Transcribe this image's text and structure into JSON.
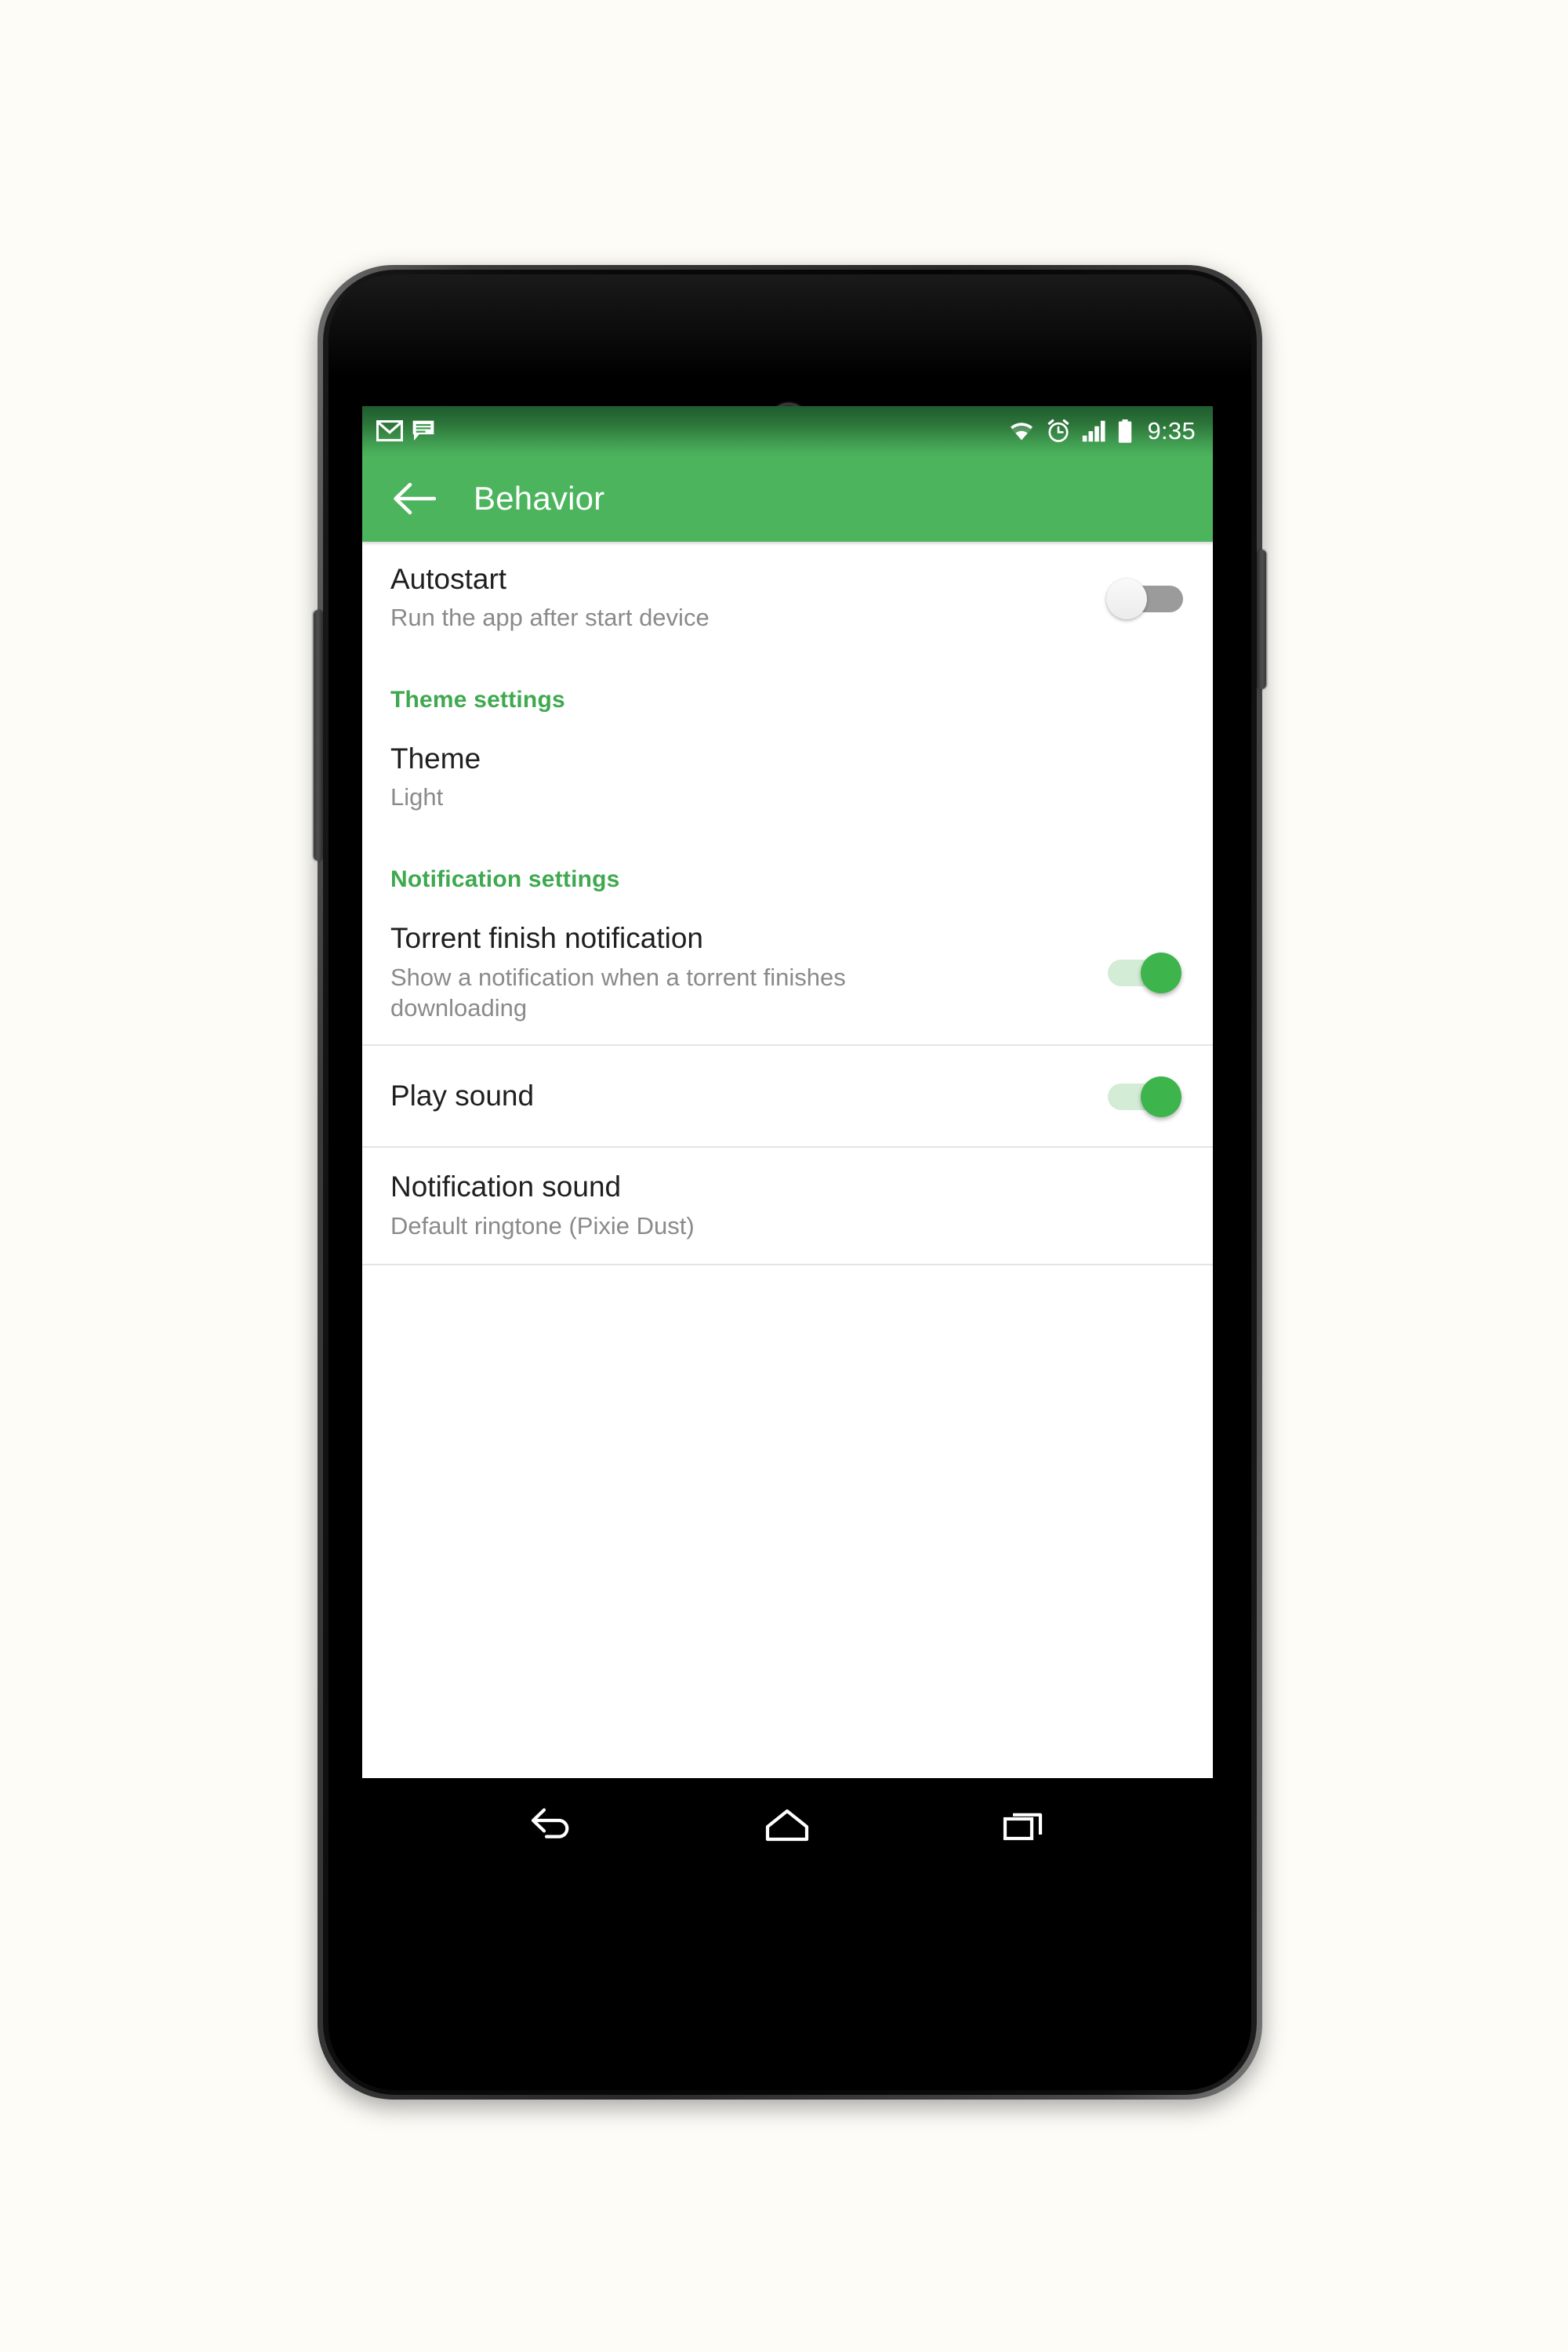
{
  "device": {
    "name": "android-phone-mockup",
    "hardware": {
      "front_camera": "front-camera",
      "earpiece": "earpiece-speaker",
      "power_button": "power-button",
      "volume_button": "volume-rocker"
    }
  },
  "statusbar": {
    "left_icons": [
      "gmail-icon",
      "messages-icon"
    ],
    "right_icons": [
      "wifi-icon",
      "alarm-icon",
      "signal-icon",
      "battery-icon"
    ],
    "time": "9:35"
  },
  "appbar": {
    "back_icon": "arrow-back-icon",
    "title": "Behavior"
  },
  "colors": {
    "accent_green": "#4CB45D",
    "section_header_green": "#3FA94F",
    "switch_on": "#3DB44C",
    "switch_on_track": "#d3ecd6",
    "switch_off_track": "#9b9b9b",
    "page_background": "#FDFCF7",
    "divider": "#e4e4e4"
  },
  "settings": {
    "items": [
      {
        "type": "switch",
        "name": "autostart",
        "title": "Autostart",
        "summary": "Run the app after start device",
        "checked": false
      },
      {
        "type": "section",
        "name": "theme-settings",
        "title": "Theme settings"
      },
      {
        "type": "value",
        "name": "theme",
        "title": "Theme",
        "summary": "Light"
      },
      {
        "type": "section",
        "name": "notification-settings",
        "title": "Notification settings"
      },
      {
        "type": "switch",
        "name": "torrent-finish-notification",
        "title": "Torrent finish notification",
        "summary": "Show a notification when a torrent finishes downloading",
        "checked": true
      },
      {
        "type": "switch",
        "name": "play-sound",
        "title": "Play sound",
        "summary": "",
        "checked": true
      },
      {
        "type": "value",
        "name": "notification-sound",
        "title": "Notification sound",
        "summary": "Default ringtone (Pixie Dust)"
      }
    ]
  },
  "navbar": {
    "keys": [
      {
        "name": "back-nav-button",
        "icon": "back-arrow-icon"
      },
      {
        "name": "home-nav-button",
        "icon": "home-icon"
      },
      {
        "name": "recents-nav-button",
        "icon": "recents-icon"
      }
    ]
  }
}
